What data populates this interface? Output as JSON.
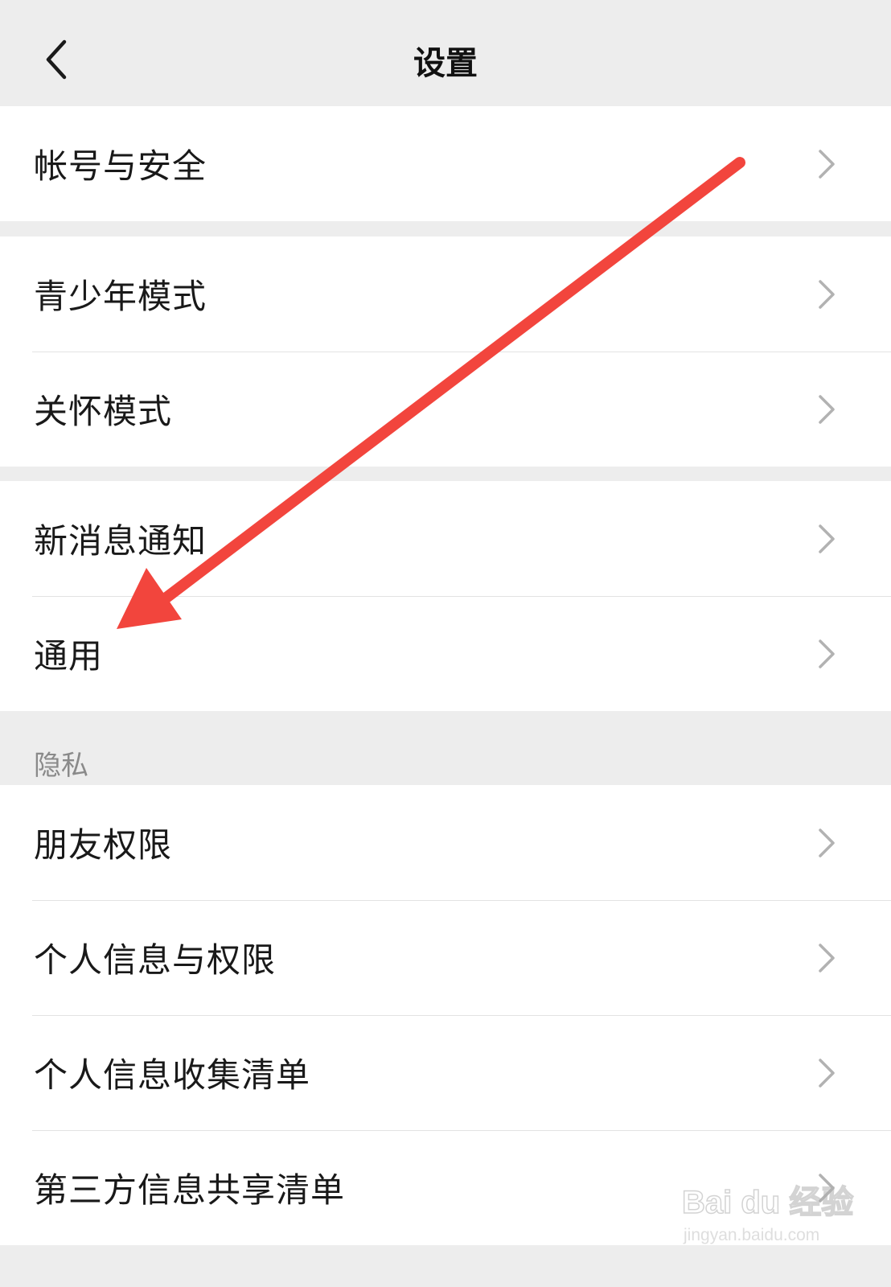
{
  "navbar": {
    "title": "设置",
    "back_icon": "chevron-left-icon"
  },
  "groups": [
    {
      "items": [
        {
          "label": "帐号与安全"
        }
      ]
    },
    {
      "items": [
        {
          "label": "青少年模式"
        },
        {
          "label": "关怀模式"
        }
      ]
    },
    {
      "items": [
        {
          "label": "新消息通知"
        },
        {
          "label": "通用"
        }
      ]
    },
    {
      "header": "隐私",
      "items": [
        {
          "label": "朋友权限"
        },
        {
          "label": "个人信息与权限"
        },
        {
          "label": "个人信息收集清单"
        },
        {
          "label": "第三方信息共享清单"
        }
      ]
    }
  ],
  "annotation": {
    "arrow_color": "#f2453d",
    "points_to": "通用"
  },
  "watermark": {
    "main": "Bai du 经验",
    "sub": "jingyan.baidu.com"
  },
  "colors": {
    "background": "#ededed",
    "row_background": "#ffffff",
    "text": "#191919",
    "chevron": "#b2b2b2"
  }
}
